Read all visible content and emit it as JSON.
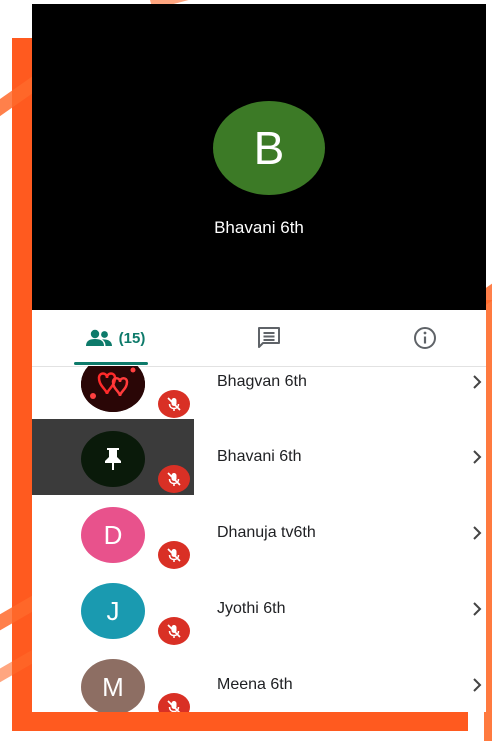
{
  "main_tile": {
    "initial": "B",
    "name": "Bhavani 6th",
    "avatar_color": "#3c7a26"
  },
  "tabs": {
    "people_count": "(15)"
  },
  "participants": [
    {
      "name": "Bhagvan 6th",
      "initial": "",
      "avatar_type": "photo"
    },
    {
      "name": "Bhavani 6th",
      "initial": "",
      "avatar_type": "pinned",
      "highlighted": true
    },
    {
      "name": "Dhanuja tv6th",
      "initial": "D",
      "avatar_color": "#e8528c"
    },
    {
      "name": "Jyothi 6th",
      "initial": "J",
      "avatar_color": "#1a9ab0"
    },
    {
      "name": "Meena 6th",
      "initial": "M",
      "avatar_color": "#8d6e63"
    }
  ],
  "colors": {
    "accent": "#0d7a6a",
    "mic_off": "#d93025",
    "frame": "#ff5a1f"
  }
}
